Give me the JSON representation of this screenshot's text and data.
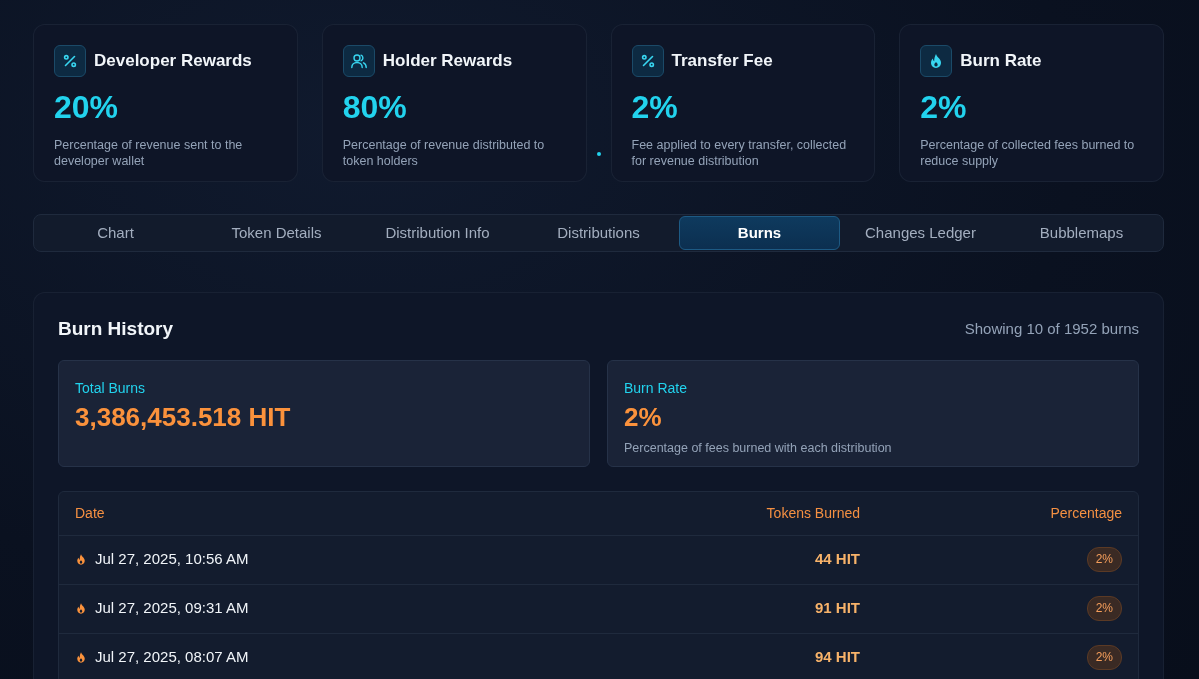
{
  "stat_cards": [
    {
      "kind": "percent",
      "title": "Developer Rewards",
      "value": "20%",
      "description": "Percentage of revenue sent to the developer wallet"
    },
    {
      "kind": "holders",
      "title": "Holder Rewards",
      "value": "80%",
      "description": "Percentage of revenue distributed to token holders"
    },
    {
      "kind": "percent",
      "title": "Transfer Fee",
      "value": "2%",
      "description": "Fee applied to every transfer, collected for revenue distribution"
    },
    {
      "kind": "burn",
      "title": "Burn Rate",
      "value": "2%",
      "description": "Percentage of collected fees burned to reduce supply"
    }
  ],
  "tabs": [
    {
      "label": "Chart",
      "selected": false
    },
    {
      "label": "Token Details",
      "selected": false
    },
    {
      "label": "Distribution Info",
      "selected": false
    },
    {
      "label": "Distributions",
      "selected": false
    },
    {
      "label": "Burns",
      "selected": true
    },
    {
      "label": "Changes Ledger",
      "selected": false
    },
    {
      "label": "Bubblemaps",
      "selected": false
    }
  ],
  "burn_history": {
    "title": "Burn History",
    "summary": "Showing 10 of 1952 burns",
    "total_burns": {
      "label": "Total Burns",
      "value": "3,386,453.518 HIT"
    },
    "burn_rate": {
      "label": "Burn Rate",
      "value": "2%",
      "description": "Percentage of fees burned with each distribution"
    },
    "table": {
      "columns": [
        "Date",
        "Tokens Burned",
        "Percentage"
      ],
      "rows": [
        {
          "date": "Jul 27, 2025, 10:56 AM",
          "tokens_burned": "44 HIT",
          "percentage": "2%"
        },
        {
          "date": "Jul 27, 2025, 09:31 AM",
          "tokens_burned": "91 HIT",
          "percentage": "2%"
        },
        {
          "date": "Jul 27, 2025, 08:07 AM",
          "tokens_burned": "94 HIT",
          "percentage": "2%"
        }
      ]
    }
  }
}
